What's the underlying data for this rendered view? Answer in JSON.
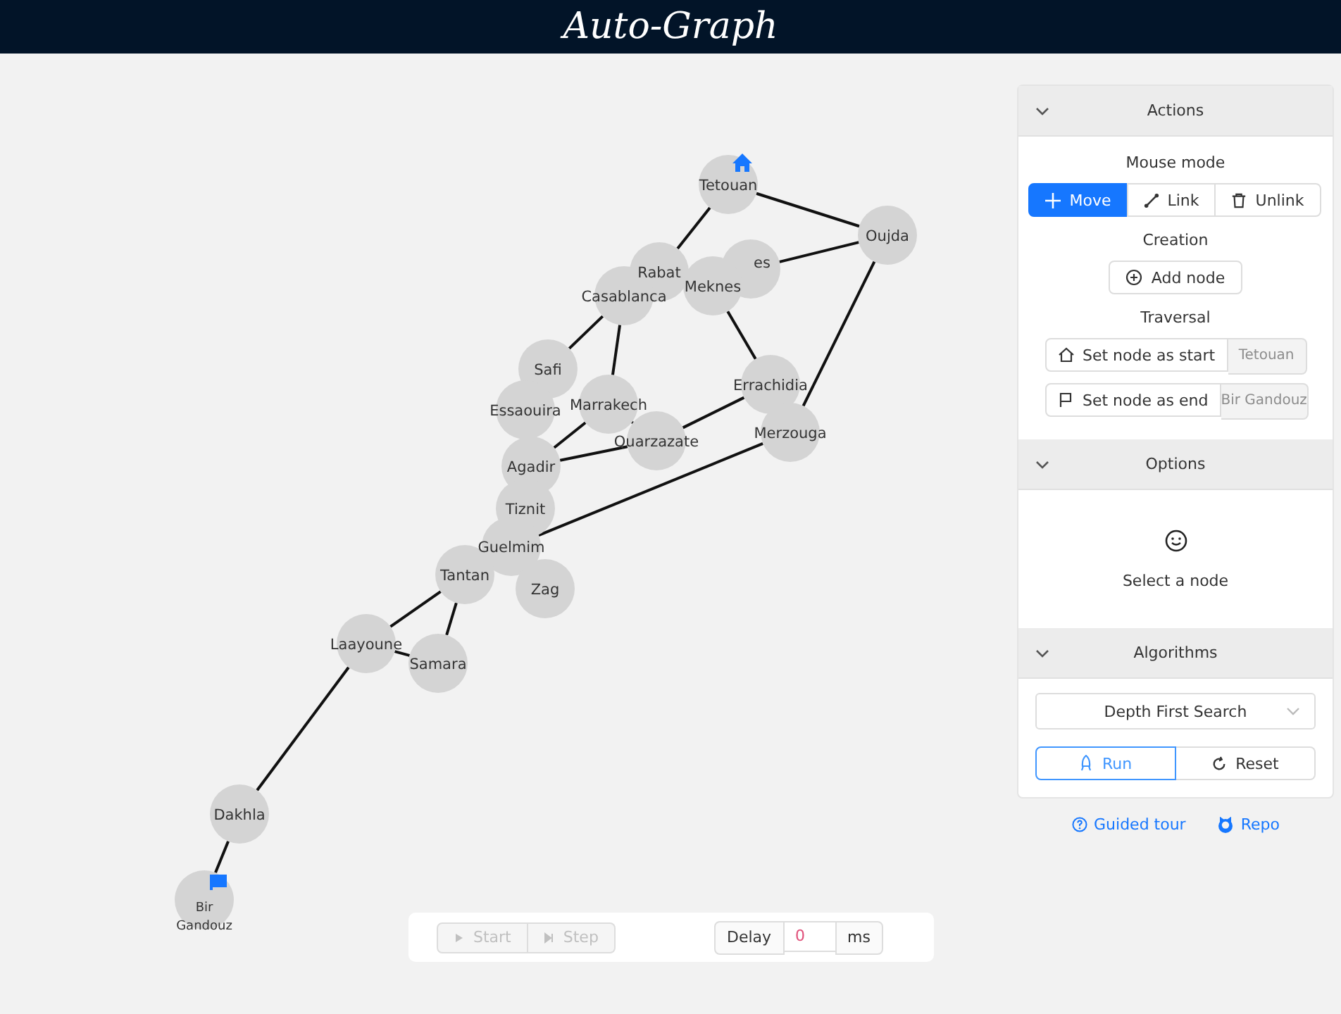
{
  "header": {
    "title": "Auto-Graph"
  },
  "graph": {
    "nodes": [
      {
        "label": "Tetouan",
        "start": true,
        "end": false
      },
      {
        "label": "Oujda",
        "start": false,
        "end": false
      },
      {
        "label": "Rabat",
        "start": false,
        "end": false
      },
      {
        "label": "es",
        "start": false,
        "end": false
      },
      {
        "label": "Meknes",
        "start": false,
        "end": false
      },
      {
        "label": "Casablanca",
        "start": false,
        "end": false
      },
      {
        "label": "Safi",
        "start": false,
        "end": false
      },
      {
        "label": "Essaouira",
        "start": false,
        "end": false
      },
      {
        "label": "Marrakech",
        "start": false,
        "end": false
      },
      {
        "label": "Quarzazate",
        "start": false,
        "end": false
      },
      {
        "label": "Errachidia",
        "start": false,
        "end": false
      },
      {
        "label": "Merzouga",
        "start": false,
        "end": false
      },
      {
        "label": "Agadir",
        "start": false,
        "end": false
      },
      {
        "label": "Tiznit",
        "start": false,
        "end": false
      },
      {
        "label": "Guelmim",
        "start": false,
        "end": false
      },
      {
        "label": "Tantan",
        "start": false,
        "end": false
      },
      {
        "label": "Zag",
        "start": false,
        "end": false
      },
      {
        "label": "Laayoune",
        "start": false,
        "end": false
      },
      {
        "label": "Samara",
        "start": false,
        "end": false
      },
      {
        "label": "Dakhla",
        "start": false,
        "end": false
      },
      {
        "label": "Bir\nGandouz",
        "start": false,
        "end": true
      }
    ]
  },
  "panel": {
    "sections": [
      {
        "kind": "actions",
        "title": "Actions",
        "expanded": true,
        "mouse_mode": {
          "label": "Mouse mode",
          "options": [
            {
              "label": "Move",
              "selected": true
            },
            {
              "label": "Link",
              "selected": false
            },
            {
              "label": "Unlink",
              "selected": false
            }
          ]
        },
        "creation": {
          "label": "Creation",
          "button": "Add node"
        },
        "traversal": {
          "label": "Traversal",
          "start_button": "Set node as start",
          "start_value": "Tetouan",
          "end_button": "Set node as end",
          "end_value": "Bir Gandouz"
        }
      },
      {
        "kind": "options",
        "title": "Options",
        "expanded": true,
        "empty_text": "Select a node"
      },
      {
        "kind": "algorithms",
        "title": "Algorithms",
        "expanded": true,
        "select_value": "Depth First Search",
        "buttons": [
          {
            "label": "Run",
            "active": true
          },
          {
            "label": "Reset",
            "active": false
          }
        ]
      }
    ],
    "links": [
      "Guided tour",
      "Repo"
    ]
  },
  "toolbar": {
    "buttons": [
      {
        "label": "Start",
        "disabled": true
      },
      {
        "label": "Step",
        "disabled": true
      }
    ],
    "delay_label": "Delay",
    "delay_value": "0",
    "delay_unit": "ms"
  }
}
